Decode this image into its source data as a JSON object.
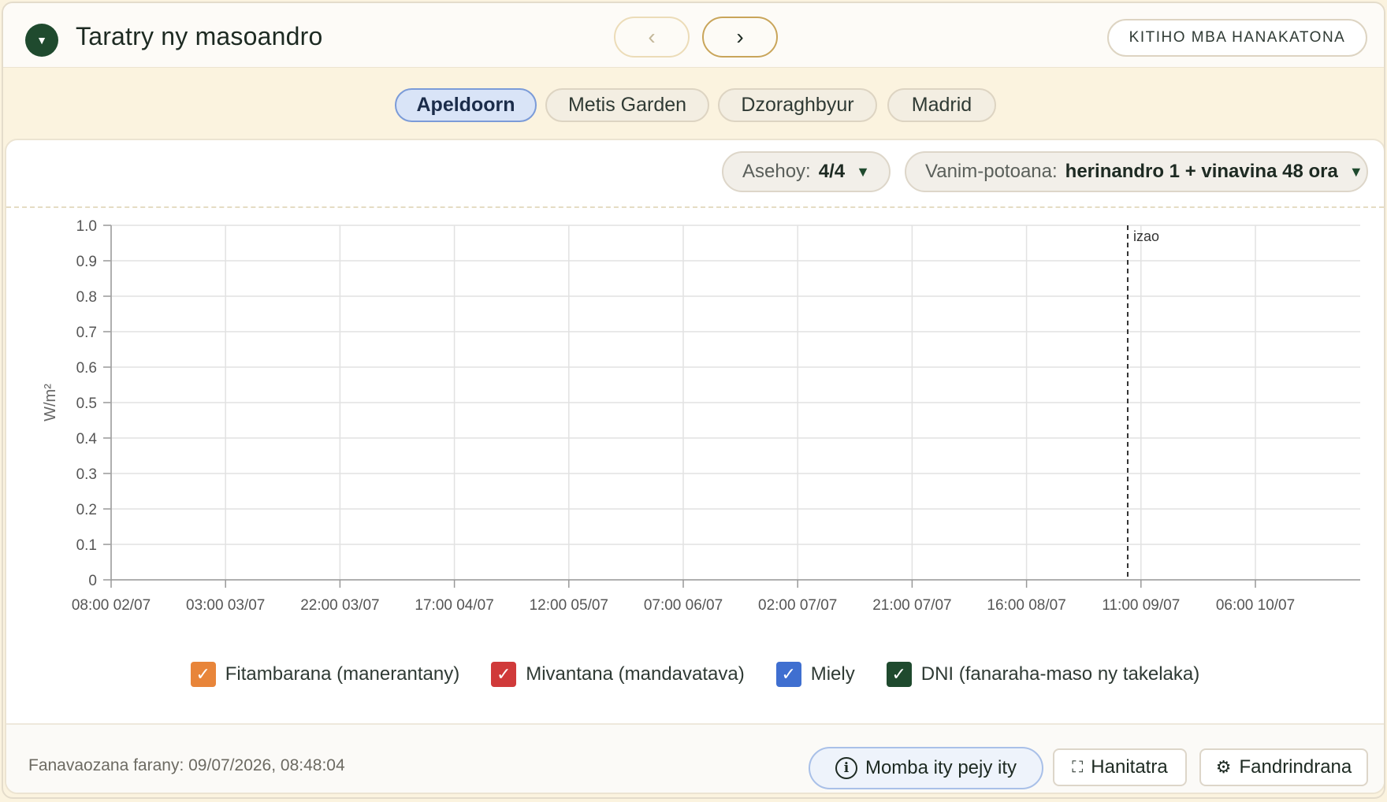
{
  "header": {
    "title": "Taratry ny masoandro",
    "prev_label": "‹",
    "next_label": "›",
    "action_label": "KITIHO MBA HANAKATONA"
  },
  "tabs": [
    {
      "label": "Apeldoorn",
      "active": true
    },
    {
      "label": "Metis Garden",
      "active": false
    },
    {
      "label": "Dzoraghbyur",
      "active": false
    },
    {
      "label": "Madrid",
      "active": false
    }
  ],
  "toolbar": {
    "series_select": {
      "label": "Asehoy:",
      "value": "4/4"
    },
    "range_select": {
      "label": "Vanim-potoana:",
      "value": "herinandro 1 + vinavina 48 ora"
    }
  },
  "chart_data": {
    "type": "line",
    "title": "",
    "xlabel": "",
    "ylabel": "W/m²",
    "ylim": [
      0,
      1
    ],
    "y_ticks": [
      "0",
      "0.1",
      "0.2",
      "0.3",
      "0.4",
      "0.5",
      "0.6",
      "0.7",
      "0.8",
      "0.9",
      "1.0"
    ],
    "x_ticks": [
      "08:00 02/07",
      "03:00 03/07",
      "22:00 03/07",
      "17:00 04/07",
      "12:00 05/07",
      "07:00 06/07",
      "02:00 07/07",
      "21:00 07/07",
      "16:00 08/07",
      "11:00 09/07",
      "06:00 10/07"
    ],
    "grid": true,
    "now_marker": {
      "label": "izao",
      "x": "08:48 09/07"
    },
    "series": [
      {
        "name": "Fitambarana (manerantany)",
        "color": "#e8853a",
        "values": []
      },
      {
        "name": "Mivantana (mandavatava)",
        "color": "#d03a3a",
        "values": []
      },
      {
        "name": "Miely",
        "color": "#3f6fd0",
        "values": []
      },
      {
        "name": "DNI (fanaraha-maso ny takelaka)",
        "color": "#1f4a2e",
        "values": []
      }
    ]
  },
  "footer": {
    "last_update": "Fanavaozana farany: 09/07/2026, 08:48:04",
    "info_label": "Momba ity pejy ity",
    "fullscreen_label": "Hanitatra",
    "settings_label": "Fandrindrana"
  },
  "icons": {
    "collapse": "triangle-down-icon",
    "fullscreen": "expand-icon",
    "settings": "gear-icon",
    "info": "info-icon"
  }
}
